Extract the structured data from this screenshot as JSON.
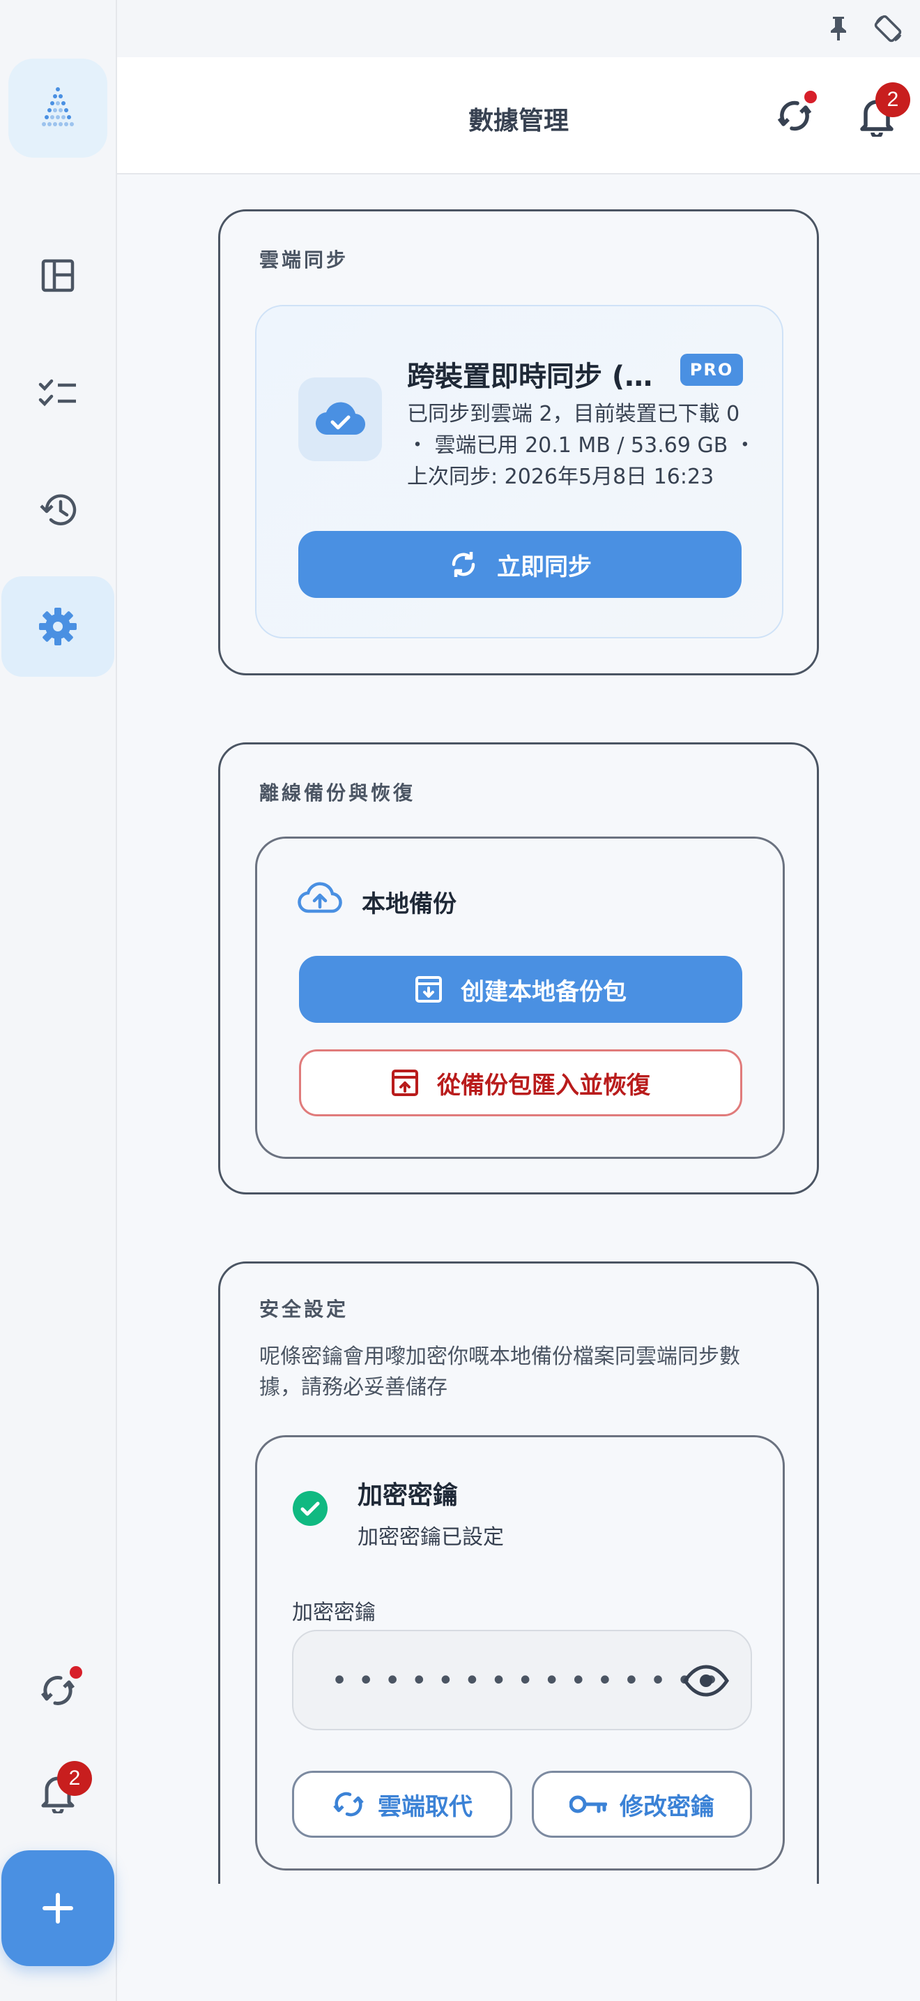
{
  "header": {
    "title": "數據管理",
    "notification_count": "2"
  },
  "sidebar": {
    "notification_count": "2",
    "items": [
      {
        "name": "dashboard",
        "icon": "layout-icon"
      },
      {
        "name": "tasks",
        "icon": "checklist-icon"
      },
      {
        "name": "history",
        "icon": "history-icon"
      },
      {
        "name": "settings",
        "icon": "gear-icon",
        "active": true
      }
    ]
  },
  "cloud_sync": {
    "section_title": "雲端同步",
    "title": "跨裝置即時同步 (…",
    "pro_label": "PRO",
    "description": "已同步到雲端 2，目前裝置已下載 0 ・ 雲端已用 20.1 MB / 53.69 GB ・ 上次同步: 2026年5月8日 16:23",
    "sync_button": "立即同步"
  },
  "backup": {
    "section_title": "離線備份與恢復",
    "heading": "本地備份",
    "create_button": "创建本地备份包",
    "restore_button": "從備份包匯入並恢復"
  },
  "security": {
    "section_title": "安全設定",
    "description": "呢條密鑰會用嚟加密你嘅本地備份檔案同雲端同步數據，請務必妥善儲存",
    "key_title": "加密密鑰",
    "key_status": "加密密鑰已設定",
    "field_label": "加密密鑰",
    "masked_value": "•••••••••••••••",
    "cloud_replace_button": "雲端取代",
    "change_key_button": "修改密鑰"
  },
  "colors": {
    "accent": "#4a90e2",
    "danger": "#b91c1c",
    "success": "#10b981",
    "badge": "#c81e1e"
  }
}
